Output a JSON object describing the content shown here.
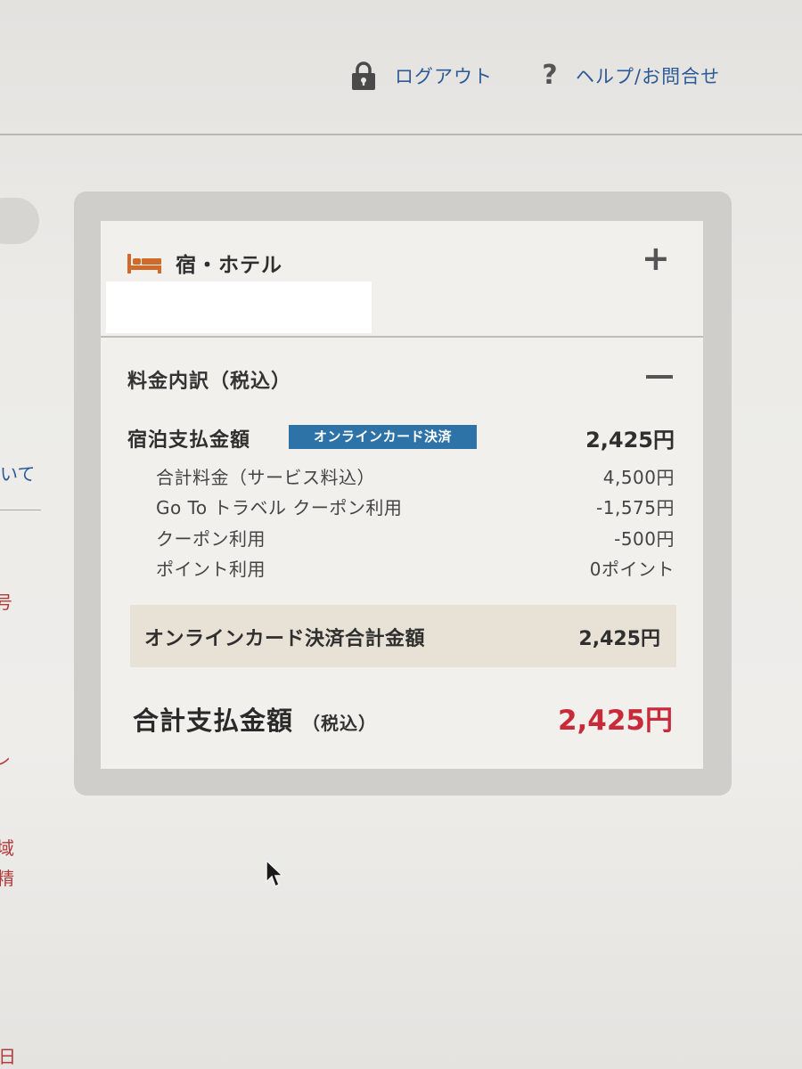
{
  "header": {
    "logout_label": "ログアウト",
    "help_label": "ヘルプ/お問合せ",
    "link_color": "#2c5a98"
  },
  "left_column": {
    "fragments": [
      "いて",
      "号",
      "レ",
      "域",
      "精",
      "日"
    ]
  },
  "hotel": {
    "title": "宿・ホテル",
    "expand_symbol": "+",
    "icon": "bed-icon",
    "icon_color": "#d06a2a"
  },
  "fees": {
    "title": "料金内訳（税込）",
    "stay_label": "宿泊支払金額",
    "payment_badge": "オンラインカード決済",
    "badge_color": "#2e73a8",
    "stay_amount": "2,425円",
    "details": [
      {
        "label": "合計料金（サービス料込）",
        "value": "4,500円"
      },
      {
        "label": "Go To トラベル クーポン利用",
        "value": "-1,575円"
      },
      {
        "label": "クーポン利用",
        "value": "-500円"
      },
      {
        "label": "ポイント利用",
        "value": "0ポイント"
      }
    ],
    "card_total_label": "オンラインカード決済合計金額",
    "card_total_value": "2,425円",
    "grand_total_label": "合計支払金額",
    "grand_total_sub": "（税込）",
    "grand_total_value": "2,425円",
    "grand_total_color": "#c92a3a"
  }
}
